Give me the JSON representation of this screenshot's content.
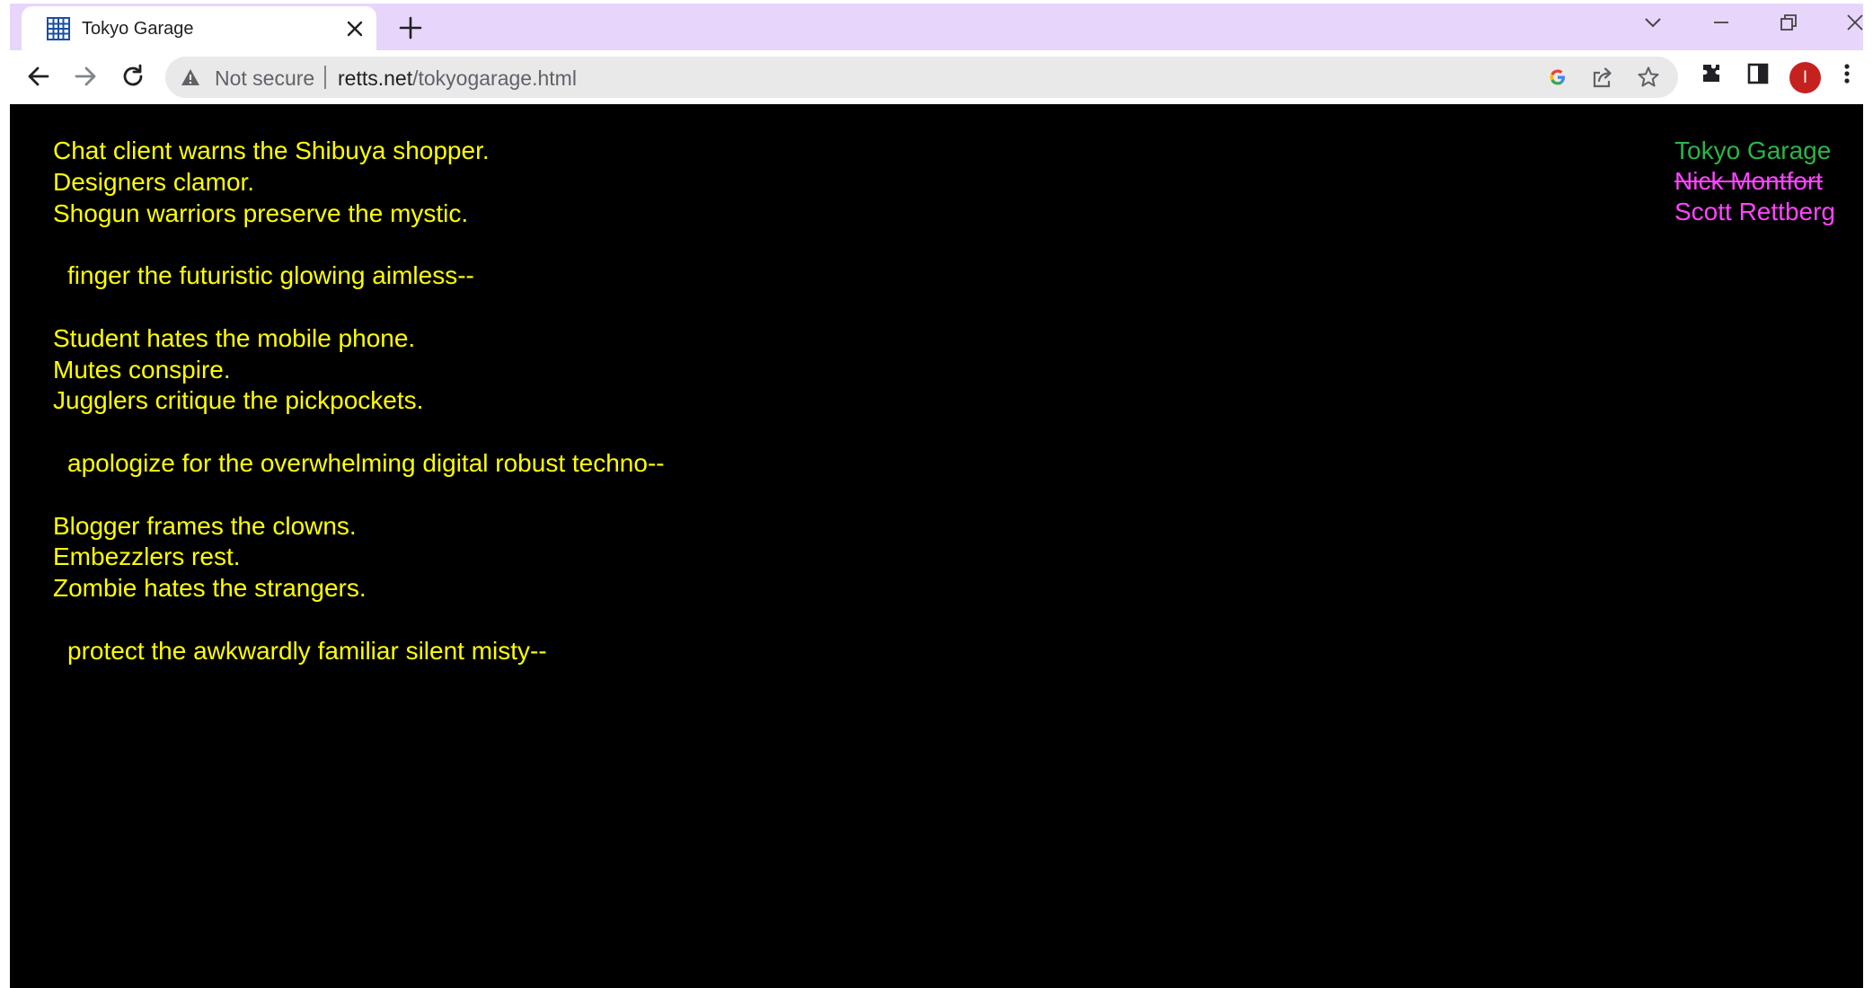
{
  "browser": {
    "tab": {
      "title": "Tokyo Garage",
      "favicon": "grid-favicon-icon"
    },
    "address": {
      "security_label": "Not secure",
      "url_host": "retts.net",
      "url_path": "/tokyogarage.html"
    },
    "profile_initial": "I",
    "accent_color": "#e8d5fb"
  },
  "poem": {
    "stanzas": [
      {
        "lines": [
          "Chat client warns the Shibuya shopper.",
          "Designers clamor.",
          "Shogun warriors preserve the mystic."
        ],
        "refrain": "finger the futuristic glowing aimless--"
      },
      {
        "lines": [
          "Student hates the mobile phone.",
          "Mutes conspire.",
          "Jugglers critique the pickpockets."
        ],
        "refrain": "apologize for the overwhelming digital robust techno--"
      },
      {
        "lines": [
          "Blogger frames the clowns.",
          "Embezzlers rest.",
          "Zombie hates the strangers."
        ],
        "refrain": "protect the awkwardly familiar silent misty--"
      }
    ],
    "text_color": "#ffff00"
  },
  "credits": {
    "title": "Tokyo Garage",
    "struck_author": "Nick Montfort",
    "author": "Scott Rettberg",
    "title_color": "#2ab54a",
    "author_color": "#ff44ff"
  }
}
